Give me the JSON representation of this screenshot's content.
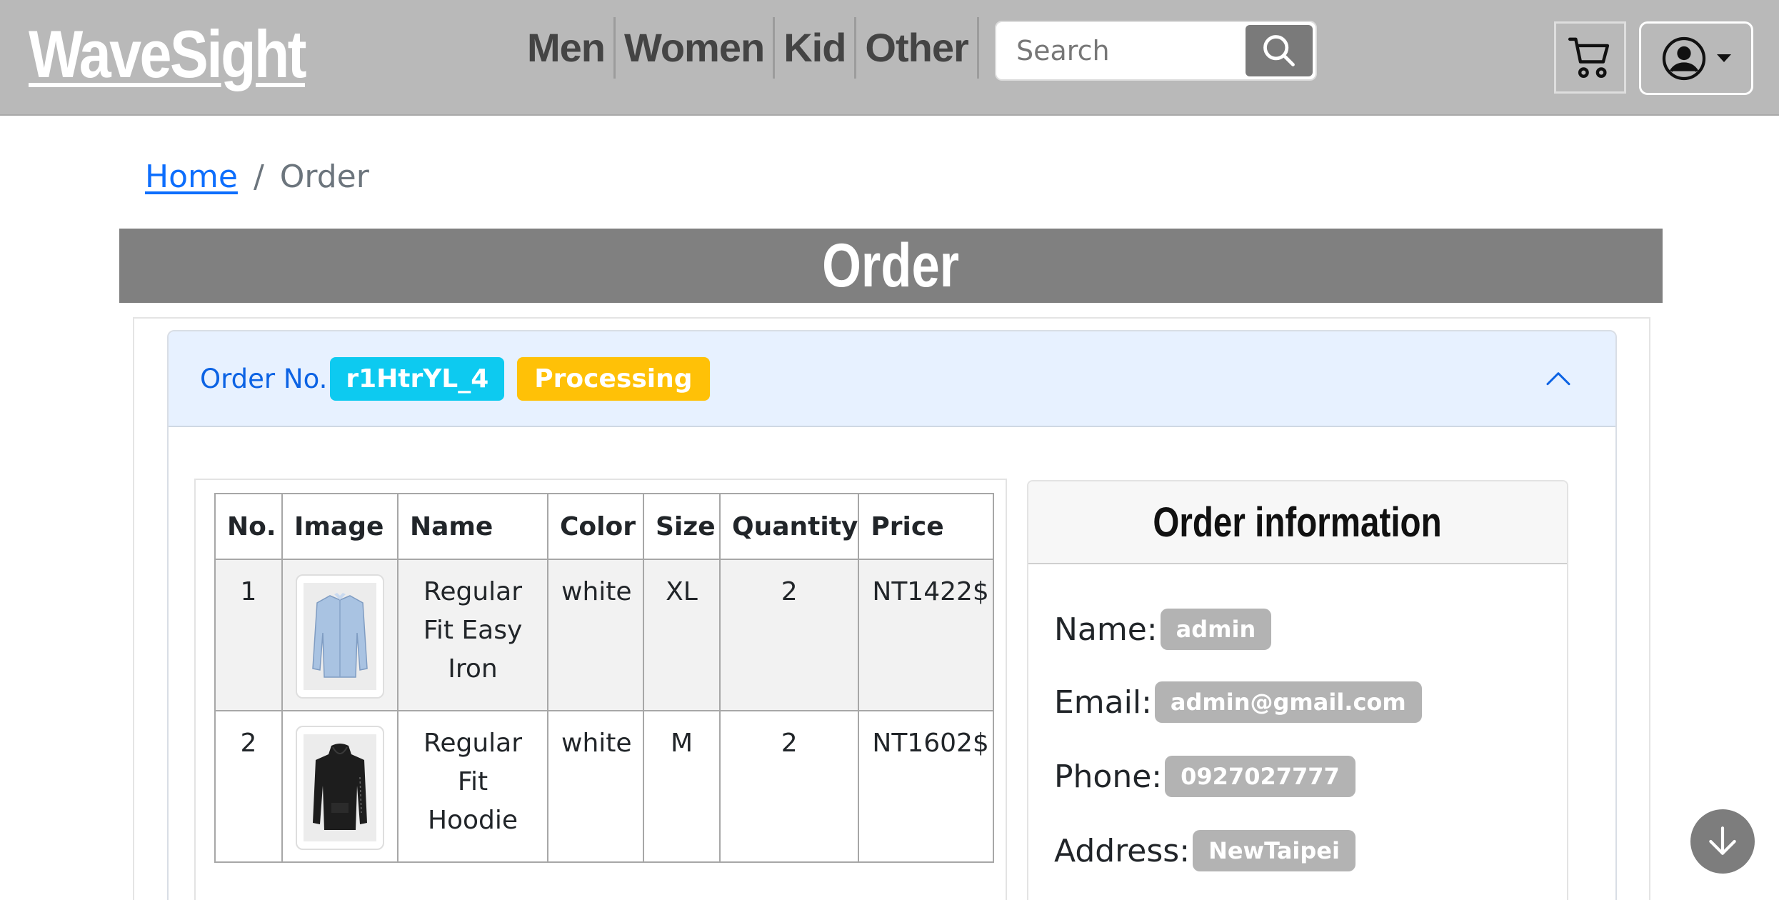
{
  "navbar": {
    "brand": "WaveSight",
    "links": [
      "Men",
      "Women",
      "Kid",
      "Other"
    ],
    "search": {
      "placeholder": "Search",
      "value": ""
    },
    "icons": {
      "search": "search-icon",
      "cart": "cart-icon",
      "user": "user-circle-icon",
      "caret": "caret-down-icon"
    }
  },
  "breadcrumb": {
    "home": "Home",
    "separator": "/",
    "current": "Order"
  },
  "page": {
    "title": "Order"
  },
  "order": {
    "label": "Order No.",
    "number": "r1HtrYL_4",
    "status": "Processing",
    "expanded": true
  },
  "items_table": {
    "headers": [
      "No.",
      "Image",
      "Name",
      "Color",
      "Size",
      "Quantity",
      "Price"
    ],
    "rows": [
      {
        "no": "1",
        "image": "light-blue-shirt",
        "name": [
          "Regular",
          "Fit Easy",
          "Iron"
        ],
        "color": "white",
        "size": "XL",
        "quantity": "2",
        "price": "NT1422$"
      },
      {
        "no": "2",
        "image": "black-hoodie",
        "name": [
          "Regular",
          "Fit",
          "Hoodie"
        ],
        "color": "white",
        "size": "M",
        "quantity": "2",
        "price": "NT1602$"
      }
    ]
  },
  "order_info": {
    "title": "Order information",
    "fields": {
      "name": {
        "label": "Name:",
        "value": "admin"
      },
      "email": {
        "label": "Email:",
        "value": "admin@gmail.com"
      },
      "phone": {
        "label": "Phone:",
        "value": "0927027777"
      },
      "address": {
        "label": "Address:",
        "value": "NewTaipei"
      }
    }
  },
  "colors": {
    "navbar": "#b9b9b9",
    "banner": "#808080",
    "accordion_header": "#e7f1ff",
    "order_badge": "#0dcaf0",
    "status_badge": "#ffc107",
    "info_badge": "#b3b3b3",
    "link": "#0d6efd"
  }
}
